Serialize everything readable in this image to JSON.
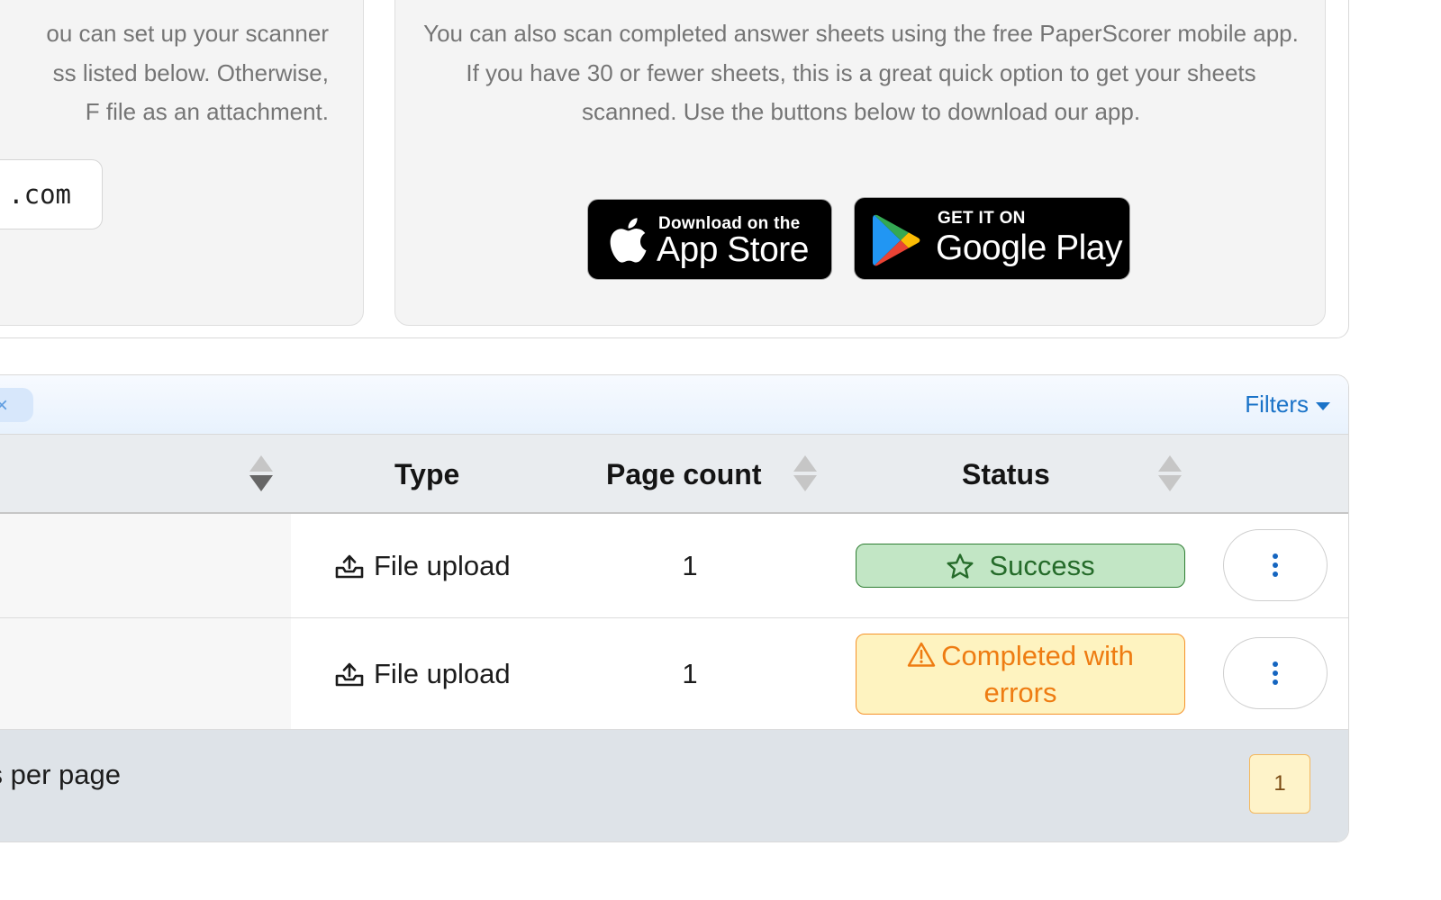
{
  "scan_email": {
    "description": "ou can set up your scanner ss listed below. Otherwise, F file as an attachment.",
    "description_lines": [
      "ou can set up your scanner",
      "ss listed below. Otherwise,",
      "F file as an attachment."
    ],
    "email_fragment": ".com"
  },
  "scan_app": {
    "description": "You can also scan completed answer sheets using the free PaperScorer mobile app. If you have 30 or fewer sheets, this is a great quick option to get your sheets scanned. Use the buttons below to download our app.",
    "app_store": {
      "small": "Download on the",
      "big": "App Store"
    },
    "google_play": {
      "small": "GET IT ON",
      "big": "Google Play"
    }
  },
  "table": {
    "filter_chip_close": "×",
    "filters_label": "Filters",
    "columns": {
      "type": "Type",
      "page_count": "Page count",
      "status": "Status"
    },
    "rows": [
      {
        "type": "File upload",
        "page_count": "1",
        "status": "Success",
        "status_kind": "success"
      },
      {
        "type": "File upload",
        "page_count": "1",
        "status": "Completed with errors",
        "status_kind": "warning"
      }
    ],
    "footer": {
      "per_page_label": "s per page",
      "current_page": "1"
    }
  },
  "colors": {
    "link_blue": "#1a73c8",
    "success_bg": "#c2e6c5",
    "success_border": "#2e7d32",
    "warning_bg": "#fef3c0",
    "warning_border": "#f5922a",
    "kebab": "#1565c0",
    "page_btn_bg": "#fef3c9"
  },
  "icons": {
    "apple": "apple-logo-icon",
    "google_play": "google-play-logo-icon",
    "upload": "upload-tray-icon",
    "star": "star-outline-icon",
    "warning": "warning-triangle-icon",
    "menu": "kebab-menu-icon",
    "chip_close": "close-icon",
    "filters_caret": "caret-down-icon"
  }
}
